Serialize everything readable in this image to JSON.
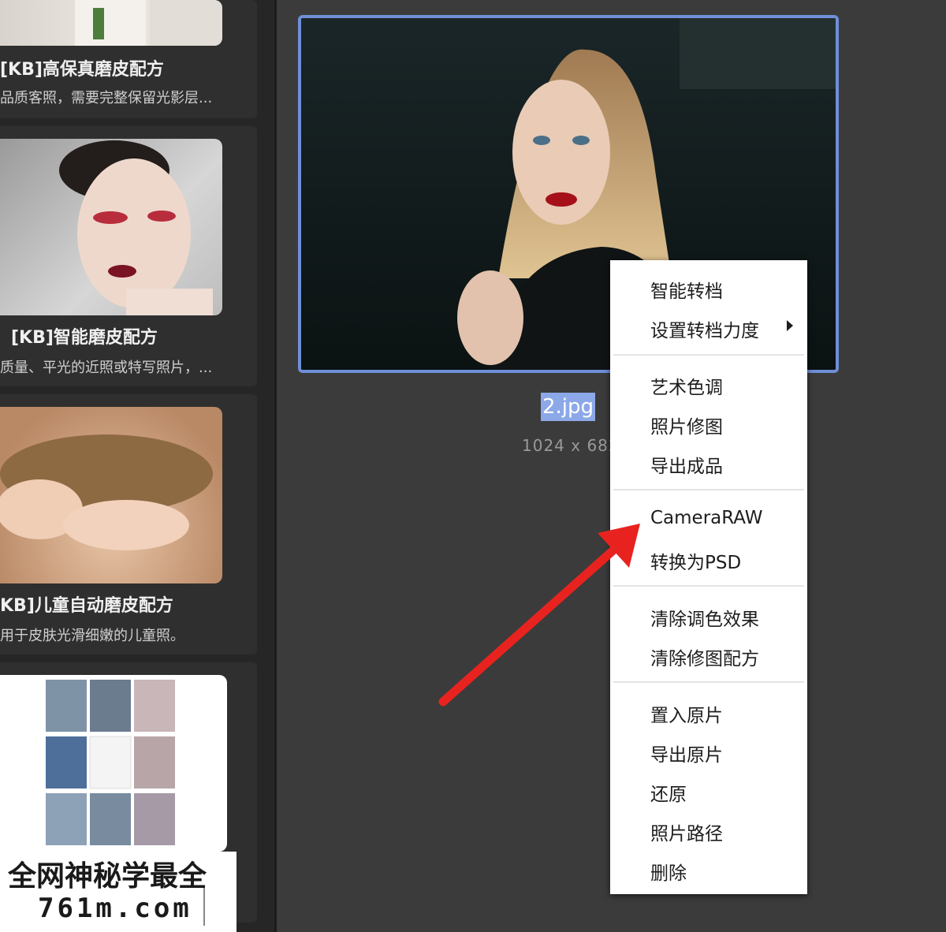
{
  "cards": [
    {
      "title": "[KB]高保真磨皮配方",
      "desc": "品质客照，需要完整保留光影层..."
    },
    {
      "title": "[KB]智能磨皮配方",
      "desc": "质量、平光的近照或特写照片，..."
    },
    {
      "title": "KB]儿童自动磨皮配方",
      "desc": "用于皮肤光滑细嫩的儿童照。"
    }
  ],
  "photo": {
    "filename": "2.jpg",
    "dimensions": "1024 x 682"
  },
  "context_menu": {
    "items": [
      {
        "label": "智能转档"
      },
      {
        "label": "设置转档力度"
      },
      {
        "label": "艺术色调"
      },
      {
        "label": "照片修图"
      },
      {
        "label": "导出成品"
      },
      {
        "label": "CameraRAW"
      },
      {
        "label": "转换为PSD"
      },
      {
        "label": "清除调色效果"
      },
      {
        "label": "清除修图配方"
      },
      {
        "label": "置入原片"
      },
      {
        "label": "导出原片"
      },
      {
        "label": "还原"
      },
      {
        "label": "照片路径"
      },
      {
        "label": "删除"
      }
    ]
  },
  "watermark": {
    "line1": "全网神秘学最全",
    "line2": "761m.com"
  },
  "colors": {
    "selection": "#8ca8e8",
    "frame_border": "#6f8fd8",
    "arrow": "#e8231f"
  }
}
